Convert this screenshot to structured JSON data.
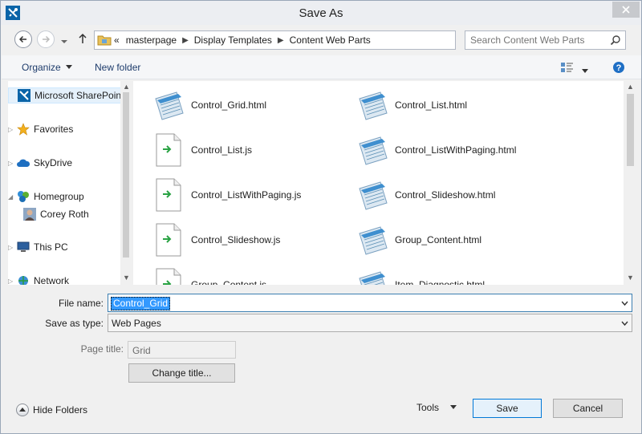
{
  "window": {
    "title": "Save As"
  },
  "address": {
    "prefix": "«",
    "crumbs": [
      "masterpage",
      "Display Templates",
      "Content Web Parts"
    ]
  },
  "search": {
    "placeholder": "Search Content Web Parts"
  },
  "toolbar": {
    "organize_label": "Organize",
    "new_folder_label": "New folder"
  },
  "nav": {
    "items": [
      {
        "label": "Microsoft SharePoint",
        "icon": "sharepoint-icon"
      },
      {
        "label": "Favorites",
        "icon": "star-icon"
      },
      {
        "label": "SkyDrive",
        "icon": "cloud-icon"
      },
      {
        "label": "Homegroup",
        "icon": "homegroup-icon"
      },
      {
        "label": "Corey Roth",
        "icon": "user-avatar-icon"
      },
      {
        "label": "This PC",
        "icon": "computer-icon"
      },
      {
        "label": "Network",
        "icon": "network-icon"
      }
    ]
  },
  "files": [
    {
      "name": "Control_Grid.html",
      "type": "html"
    },
    {
      "name": "Control_List.html",
      "type": "html"
    },
    {
      "name": "Control_List.js",
      "type": "js"
    },
    {
      "name": "Control_ListWithPaging.html",
      "type": "html"
    },
    {
      "name": "Control_ListWithPaging.js",
      "type": "js"
    },
    {
      "name": "Control_Slideshow.html",
      "type": "html"
    },
    {
      "name": "Control_Slideshow.js",
      "type": "js"
    },
    {
      "name": "Group_Content.html",
      "type": "html"
    },
    {
      "name": "Group_Content.js",
      "type": "js"
    },
    {
      "name": "Item_Diagnostic.html",
      "type": "html"
    }
  ],
  "form": {
    "filename_label": "File name:",
    "filename_value": "Control_Grid",
    "savetype_label": "Save as type:",
    "savetype_value": "Web Pages",
    "pagetitle_label": "Page title:",
    "pagetitle_value": "Grid",
    "change_title_label": "Change title..."
  },
  "footer": {
    "hide_folders_label": "Hide Folders",
    "tools_label": "Tools",
    "save_label": "Save",
    "cancel_label": "Cancel"
  },
  "colors": {
    "accent": "#0078d7",
    "selection": "#3399ff",
    "sharepoint": "#0a64a8"
  }
}
